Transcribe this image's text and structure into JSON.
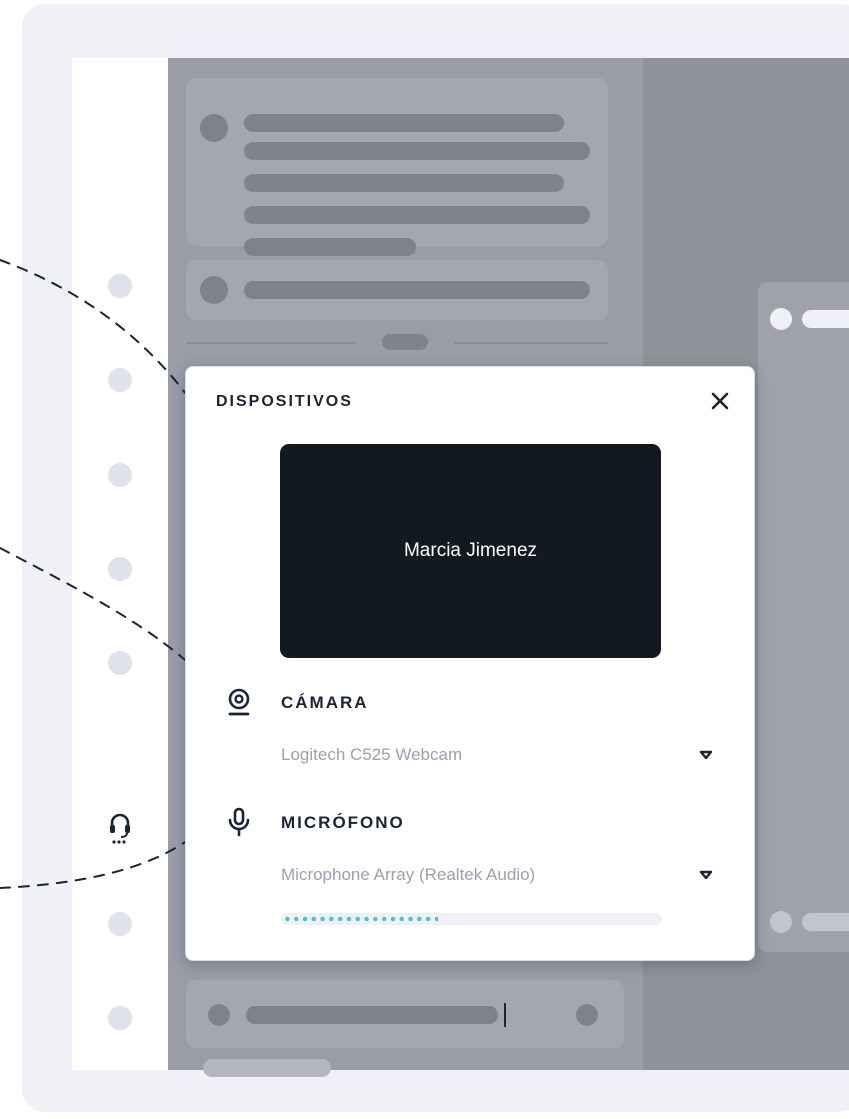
{
  "modal": {
    "title": "DISPOSITIVOS",
    "close_icon": "close-icon",
    "preview": {
      "participant_name": "Marcia Jimenez"
    },
    "camera": {
      "icon": "webcam-icon",
      "label": "CÁMARA",
      "selected_device": "Logitech C525 Webcam",
      "caret_icon": "caret-down-icon"
    },
    "microphone": {
      "icon": "microphone-icon",
      "label": "MICRÓFONO",
      "selected_device": "Microphone Array (Realtek Audio)",
      "caret_icon": "caret-down-icon",
      "input_level": 0.41
    }
  },
  "sidebar": {
    "support_icon": "headset-icon"
  },
  "colors": {
    "primary_text": "#1a2433",
    "muted_text": "#9aa1ad",
    "meter_accent": "#4fc1c3",
    "preview_background": "#131920",
    "overlay": "#9a9ca7"
  }
}
